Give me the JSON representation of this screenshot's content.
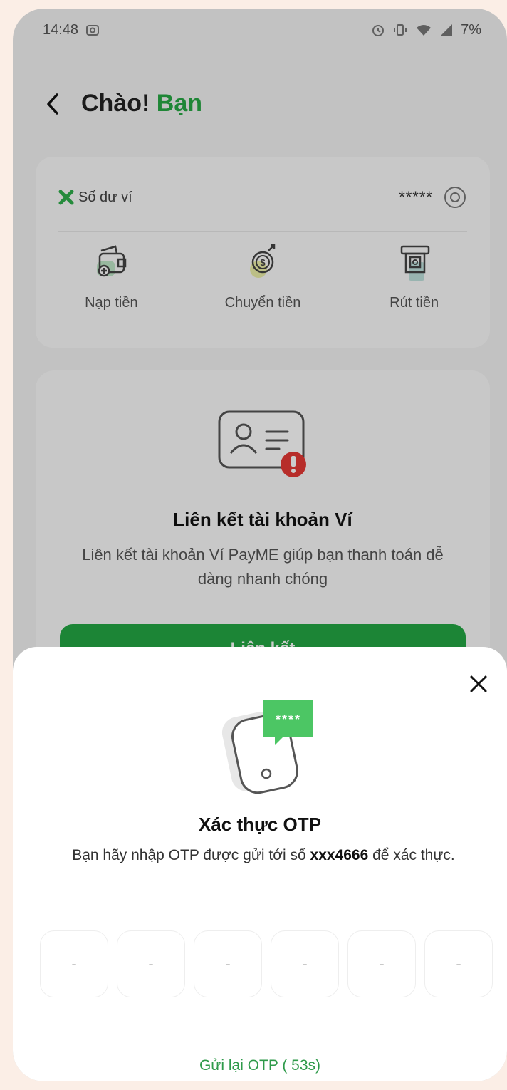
{
  "status": {
    "time": "14:48",
    "battery": "7%"
  },
  "header": {
    "greeting": "Chào!",
    "name": "Bạn"
  },
  "wallet": {
    "label": "Số dư ví",
    "balance_masked": "*****",
    "actions": [
      {
        "label": "Nạp tiền",
        "icon": "wallet-topup-icon"
      },
      {
        "label": "Chuyển tiền",
        "icon": "money-transfer-icon"
      },
      {
        "label": "Rút tiền",
        "icon": "atm-withdraw-icon"
      }
    ]
  },
  "link_card": {
    "title": "Liên kết tài khoản Ví",
    "description": "Liên kết tài khoản Ví PayME giúp bạn thanh toán dễ dàng nhanh chóng",
    "button_label": "Liên kết"
  },
  "otp_sheet": {
    "title": "Xác thực OTP",
    "desc_prefix": "Bạn hãy nhập OTP được gửi tới số",
    "phone_masked": "xxx4666",
    "desc_suffix": "để xác thực.",
    "bubble_text": "****",
    "placeholder": "-",
    "resend_label": "Gửi lại OTP ( 53s)"
  },
  "colors": {
    "brand_green": "#24a744",
    "accent_text_green": "#2e9a4a",
    "warning_red": "#e53935"
  }
}
